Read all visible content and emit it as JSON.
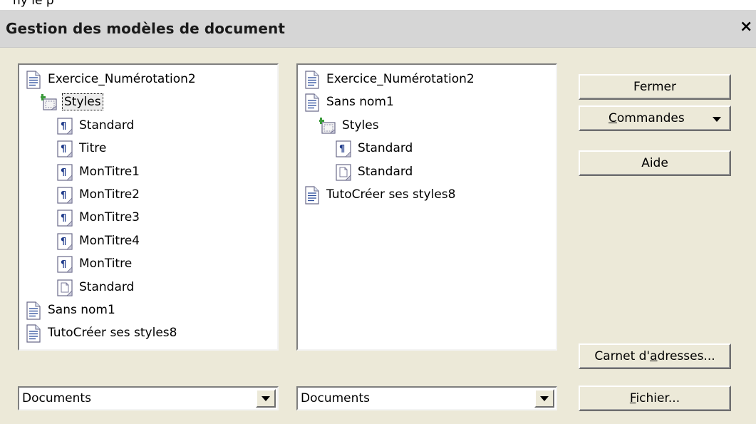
{
  "partial_top_text": "ny le p",
  "dialog": {
    "title": "Gestion des modèles de document",
    "close_glyph": "×"
  },
  "left_list": {
    "items": [
      {
        "label": "Exercice_Numérotation2",
        "icon": "document-icon",
        "selected": false
      },
      {
        "label": "Styles",
        "icon": "styles-folder-icon",
        "selected": true
      },
      {
        "label": "Standard",
        "icon": "paragraph-style-icon",
        "selected": false
      },
      {
        "label": "Titre",
        "icon": "paragraph-style-icon",
        "selected": false
      },
      {
        "label": "MonTitre1",
        "icon": "paragraph-style-icon",
        "selected": false
      },
      {
        "label": "MonTitre2",
        "icon": "paragraph-style-icon",
        "selected": false
      },
      {
        "label": "MonTitre3",
        "icon": "paragraph-style-icon",
        "selected": false
      },
      {
        "label": "MonTitre4",
        "icon": "paragraph-style-icon",
        "selected": false
      },
      {
        "label": "MonTitre",
        "icon": "paragraph-style-icon",
        "selected": false
      },
      {
        "label": "Standard",
        "icon": "page-style-icon",
        "selected": false
      },
      {
        "label": "Sans nom1",
        "icon": "document-icon",
        "selected": false
      },
      {
        "label": "TutoCréer ses styles8",
        "icon": "document-icon",
        "selected": false
      }
    ]
  },
  "right_list": {
    "items": [
      {
        "label": "Exercice_Numérotation2",
        "icon": "document-icon"
      },
      {
        "label": "Sans nom1",
        "icon": "document-icon"
      },
      {
        "label": "Styles",
        "icon": "styles-folder-icon"
      },
      {
        "label": "Standard",
        "icon": "paragraph-style-icon"
      },
      {
        "label": "Standard",
        "icon": "page-style-icon"
      },
      {
        "label": "TutoCréer ses styles8",
        "icon": "document-icon"
      }
    ]
  },
  "buttons": {
    "close": {
      "pre": "",
      "ul": "",
      "post": "Fermer"
    },
    "commands": {
      "pre": "",
      "ul": "C",
      "post": "ommandes"
    },
    "help": {
      "pre": "",
      "ul": "",
      "post": "Aide"
    },
    "address_book": {
      "pre": "Carnet d'",
      "ul": "a",
      "post": "dresses..."
    },
    "file": {
      "pre": "",
      "ul": "F",
      "post": "ichier..."
    }
  },
  "combos": {
    "left": {
      "value": "Documents"
    },
    "right": {
      "value": "Documents"
    }
  }
}
